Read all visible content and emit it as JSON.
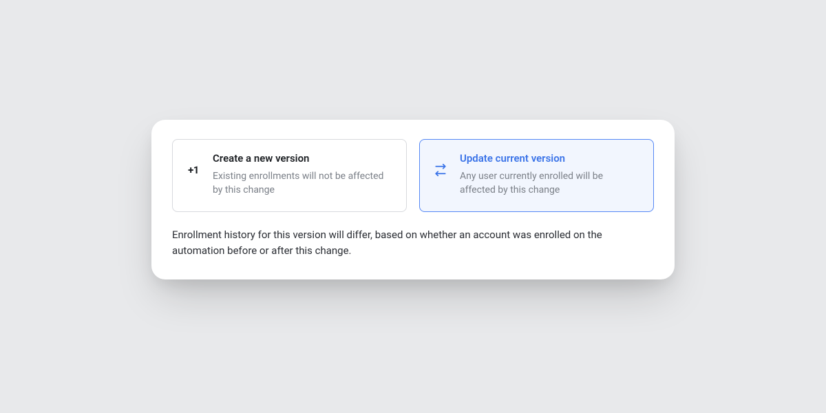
{
  "options": {
    "create": {
      "icon_label": "+1",
      "title": "Create a new version",
      "description": "Existing enrollments will not be affected by this change"
    },
    "update": {
      "title": "Update current version",
      "description": "Any user currently enrolled will be affected by this change"
    }
  },
  "help_text": "Enrollment history for this version will differ, based on whether an account was enrolled on the automation before or after this change.",
  "colors": {
    "accent": "#5487f5"
  }
}
